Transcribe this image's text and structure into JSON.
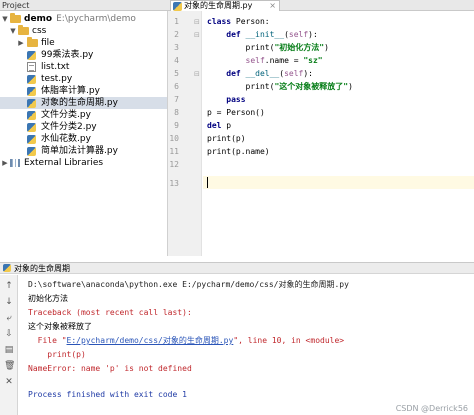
{
  "topbar": {
    "project_label": "Project",
    "editor_tab_label": "对象的生命周期.py",
    "close_glyph": "×"
  },
  "tree": {
    "root": {
      "name": "demo",
      "path": "E:\\pycharm\\demo"
    },
    "items": [
      {
        "label": "css",
        "kind": "folder",
        "expanded": true
      },
      {
        "label": "file",
        "kind": "folder",
        "expanded": false
      },
      {
        "label": "99乘法表.py",
        "kind": "py"
      },
      {
        "label": "list.txt",
        "kind": "txt"
      },
      {
        "label": "test.py",
        "kind": "py"
      },
      {
        "label": "体脂率计算.py",
        "kind": "py"
      },
      {
        "label": "对象的生命周期.py",
        "kind": "py",
        "selected": true
      },
      {
        "label": "文件分类.py",
        "kind": "py"
      },
      {
        "label": "文件分类2.py",
        "kind": "py"
      },
      {
        "label": "水仙花数.py",
        "kind": "py"
      },
      {
        "label": "简单加法计算器.py",
        "kind": "py"
      }
    ],
    "external_libraries": "External Libraries"
  },
  "editor": {
    "line_numbers": [
      "1",
      "2",
      "3",
      "4",
      "5",
      "6",
      "7",
      "8",
      "9",
      "10",
      "11",
      "12",
      "13"
    ],
    "lines": [
      {
        "kw1": "class ",
        "rest": "Person:"
      },
      {
        "indent": "    ",
        "kw1": "def ",
        "fn": "__init__",
        "p1": "(",
        "self": "self",
        "p2": "):"
      },
      {
        "indent": "        ",
        "plain": "print(",
        "str": "\"初始化方法\"",
        "close": ")"
      },
      {
        "indent": "        ",
        "self": "self",
        "plain": ".name = ",
        "str": "\"sz\""
      },
      {
        "indent": "    ",
        "kw1": "def ",
        "fn": "__del__",
        "p1": "(",
        "self": "self",
        "p2": "):"
      },
      {
        "indent": "        ",
        "plain": "print(",
        "str": "\"这个对象被释放了\"",
        "close": ")"
      },
      {
        "indent": "    ",
        "kw1": "pass"
      },
      {
        "plain": "p = Person()"
      },
      {
        "kw1": "del ",
        "plain": "p"
      },
      {
        "plain": "print(p)"
      },
      {
        "plain": "print(p.name)"
      },
      {
        "plain": ""
      },
      {
        "plain": ""
      }
    ]
  },
  "run": {
    "title": "对象的生命周期",
    "output": {
      "cmd": "D:\\software\\anaconda\\python.exe E:/pycharm/demo/css/对象的生命周期.py",
      "line_init": "初始化方法",
      "traceback": "Traceback (most recent call last):",
      "line_released": "这个对象被释放了",
      "file_prefix": "  File \"",
      "file_link": "E:/pycharm/demo/css/对象的生命周期.py",
      "file_suffix": "\", line 10, in <module>",
      "code_line": "    print(p)",
      "error": "NameError: name 'p' is not defined",
      "exit": "Process finished with exit code 1"
    },
    "toolbar_icons": [
      "rerun-up-icon",
      "down-icon",
      "wrap-icon",
      "scroll-icon",
      "print-icon",
      "trash-icon",
      "close-icon"
    ]
  },
  "watermark": "CSDN @Derrick56",
  "colors": {
    "selection": "#d7dee8",
    "keyword": "#000080",
    "string": "#067d17",
    "error": "#c0282d",
    "link": "#2a55b8"
  }
}
